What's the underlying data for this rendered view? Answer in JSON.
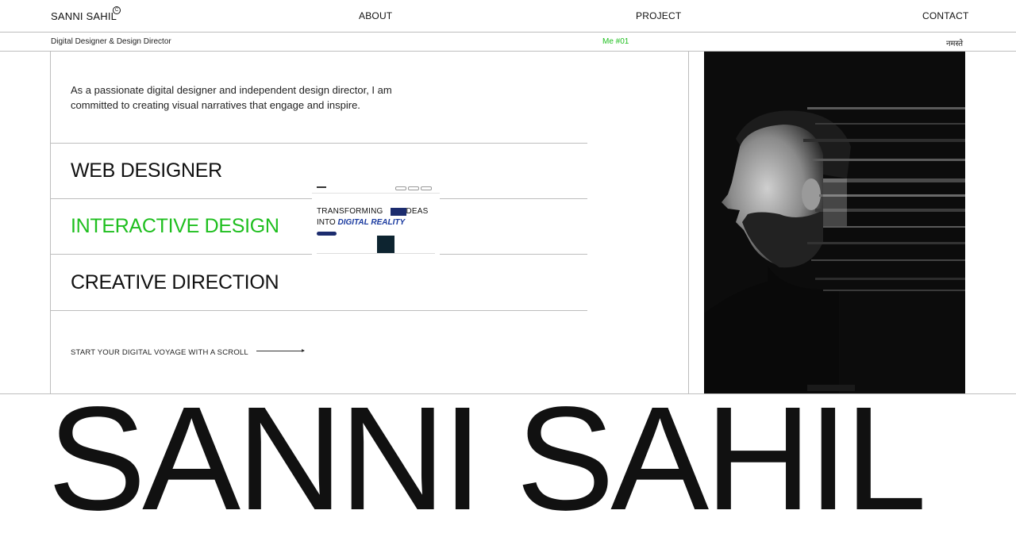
{
  "header": {
    "logo": "SANNI SAHIL",
    "logo_mark": "C",
    "nav": [
      "ABOUT",
      "PROJECT",
      "CONTACT"
    ]
  },
  "subbar": {
    "tagline": "Digital Designer & Design Director",
    "counter": "Me #01",
    "greeting": "नमस्ते"
  },
  "intro": "As a passionate digital designer and independent design director, I am committed to creating visual narratives that engage and inspire.",
  "roles": [
    {
      "label": "WEB DESIGNER"
    },
    {
      "label": "INTERACTIVE DESIGN",
      "active": true
    },
    {
      "label": "CREATIVE DIRECTION"
    }
  ],
  "preview_card": {
    "line1_a": "TRANSFORMING",
    "line1_b": "IDEAS",
    "line2_a": "INTO",
    "line2_b": "DIGITAL REALITY"
  },
  "scroll_cta": "START YOUR DIGITAL VOYAGE WITH A SCROLL",
  "big_name": "SANNI SAHIL",
  "colors": {
    "accent": "#1fbf1f",
    "text": "#111111",
    "rule": "#bdbdbd",
    "photo_bg": "#0c0c0c",
    "card_blue": "#1c2c6e"
  },
  "icons": [
    "copyright-icon",
    "arrow-right-icon"
  ]
}
